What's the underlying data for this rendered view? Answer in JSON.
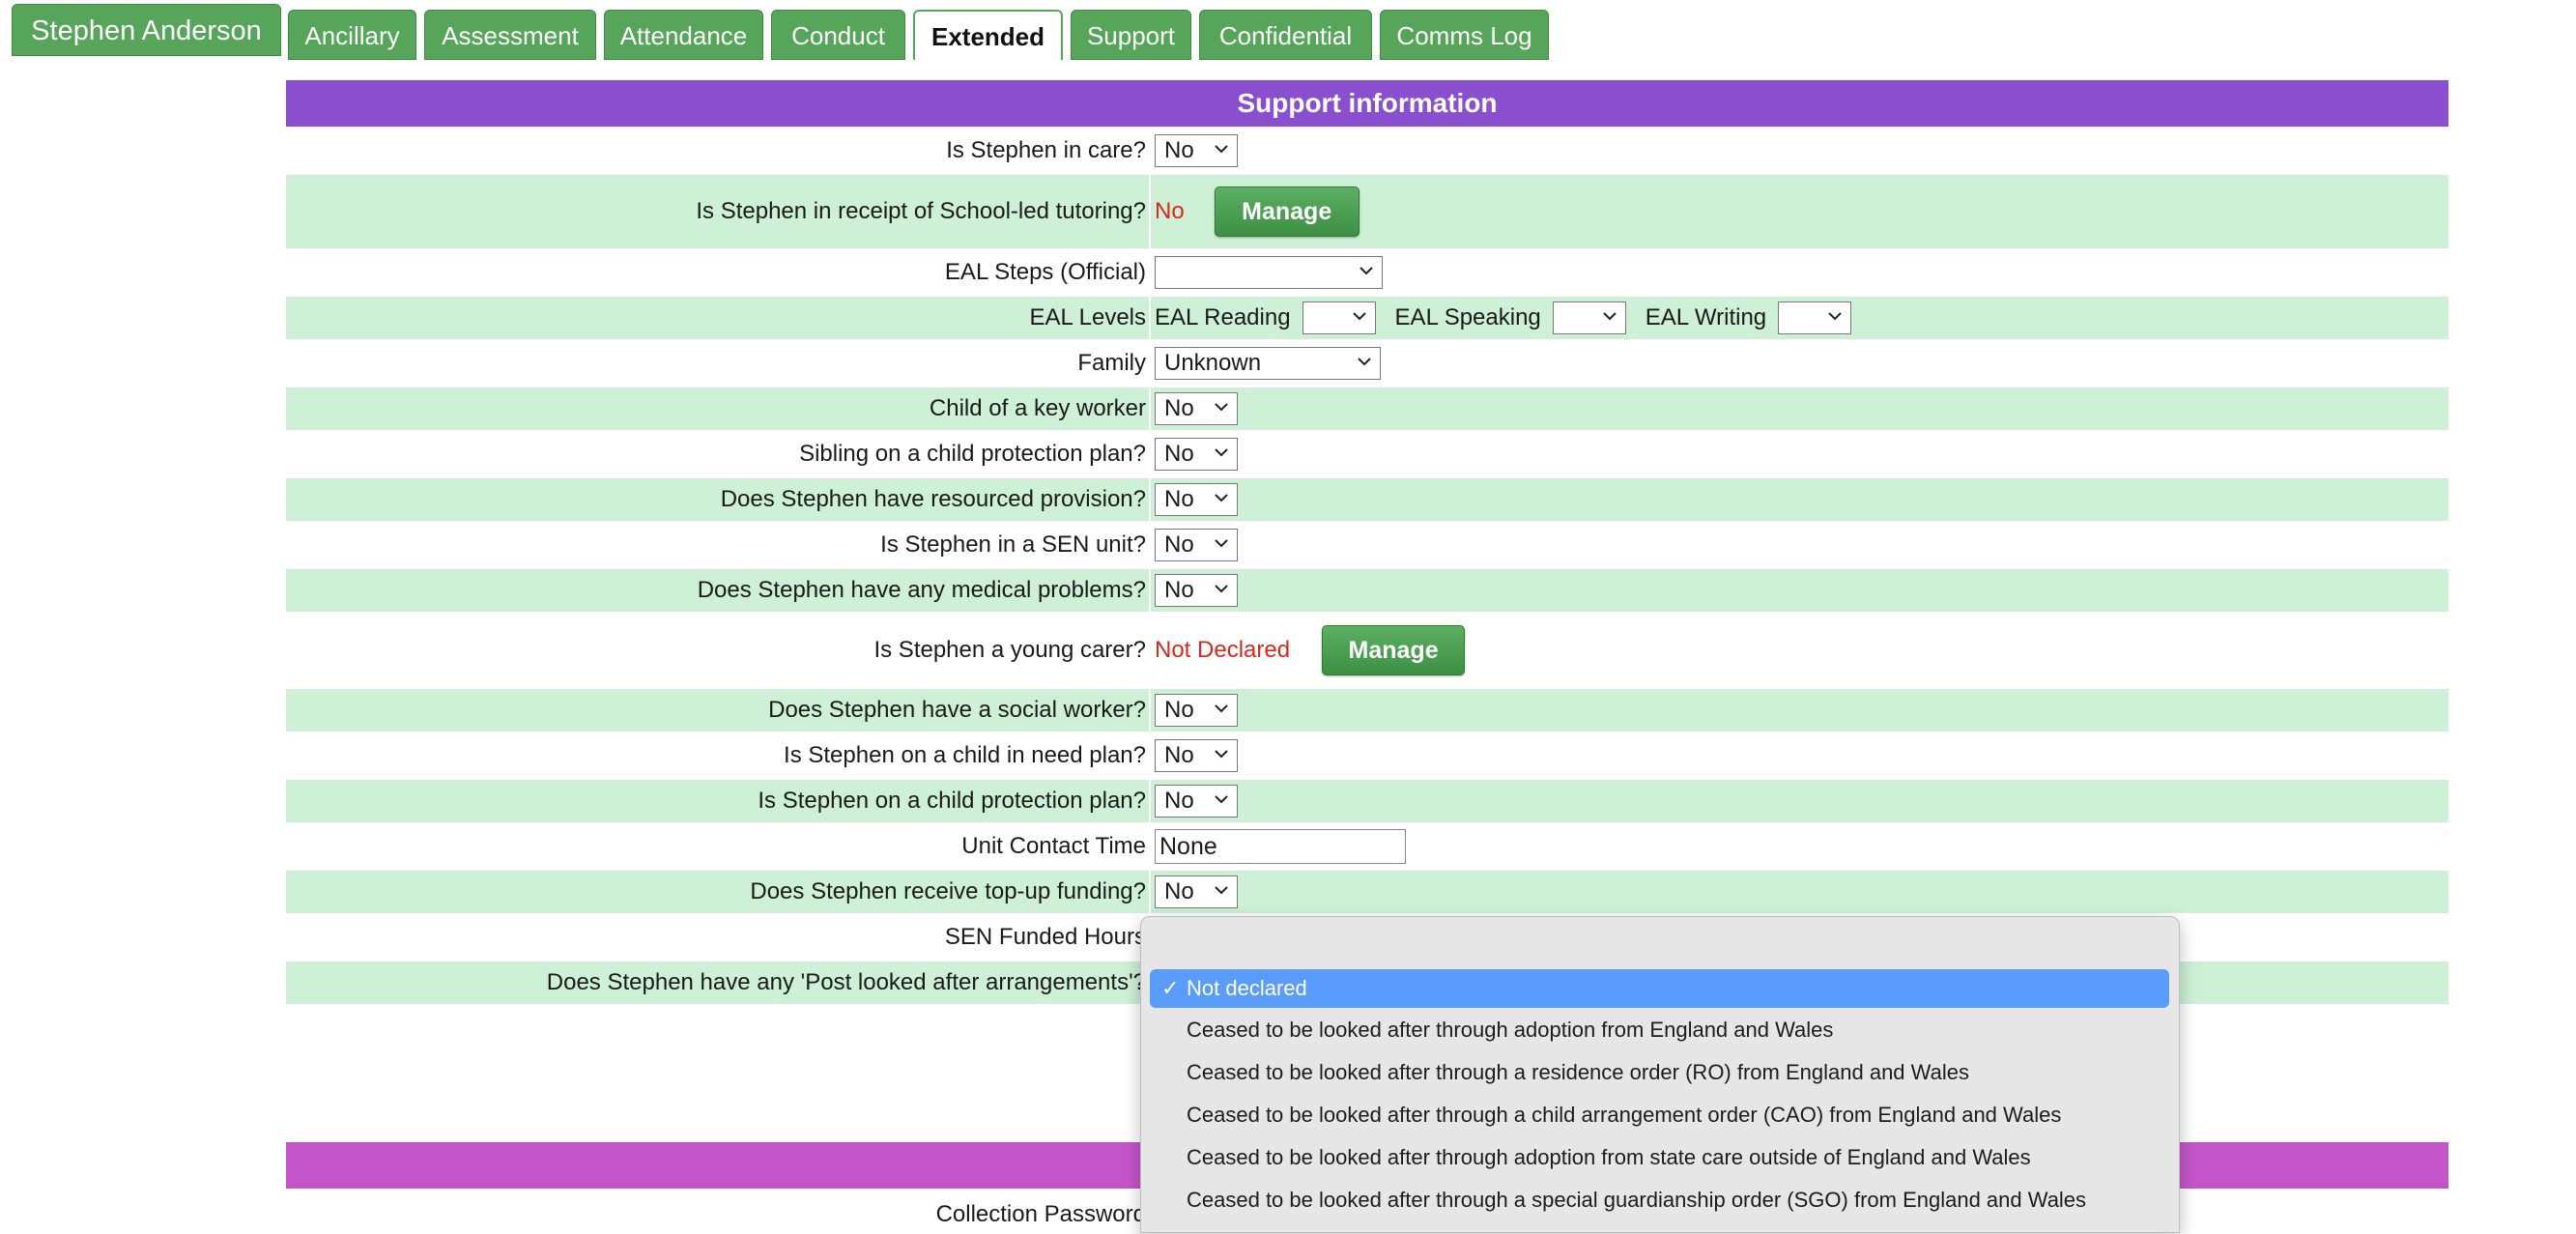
{
  "tabs": [
    {
      "label": "Stephen Anderson",
      "active": false
    },
    {
      "label": "Ancillary",
      "active": false
    },
    {
      "label": "Assessment",
      "active": false
    },
    {
      "label": "Attendance",
      "active": false
    },
    {
      "label": "Conduct",
      "active": false
    },
    {
      "label": "Extended",
      "active": true
    },
    {
      "label": "Support",
      "active": false
    },
    {
      "label": "Confidential",
      "active": false
    },
    {
      "label": "Comms Log",
      "active": false
    }
  ],
  "section_title": "Support information",
  "rows": {
    "in_care": {
      "label": "Is Stephen in care?",
      "value": "No"
    },
    "tutoring": {
      "label": "Is Stephen in receipt of School-led tutoring?",
      "value": "No",
      "button": "Manage"
    },
    "eal_steps": {
      "label": "EAL Steps (Official)",
      "value": ""
    },
    "eal_levels": {
      "label": "EAL Levels",
      "reading": "EAL Reading",
      "speaking": "EAL Speaking",
      "writing": "EAL Writing"
    },
    "family": {
      "label": "Family",
      "value": "Unknown"
    },
    "key_worker": {
      "label": "Child of a key worker",
      "value": "No"
    },
    "sibling_cp": {
      "label": "Sibling on a child protection plan?",
      "value": "No"
    },
    "resourced": {
      "label": "Does Stephen have resourced provision?",
      "value": "No"
    },
    "sen_unit": {
      "label": "Is Stephen in a SEN unit?",
      "value": "No"
    },
    "medical": {
      "label": "Does Stephen have any medical problems?",
      "value": "No"
    },
    "young_carer": {
      "label": "Is Stephen a young carer?",
      "value": "Not Declared",
      "button": "Manage"
    },
    "social_worker": {
      "label": "Does Stephen have a social worker?",
      "value": "No"
    },
    "child_need": {
      "label": "Is Stephen on a child in need plan?",
      "value": "No"
    },
    "child_protection": {
      "label": "Is Stephen on a child protection plan?",
      "value": "No"
    },
    "unit_contact": {
      "label": "Unit Contact Time",
      "value": "None"
    },
    "topup": {
      "label": "Does Stephen receive top-up funding?",
      "value": "No"
    },
    "sen_hours": {
      "label": "SEN Funded Hours"
    },
    "post_lac": {
      "label": "Does Stephen have any 'Post looked after arrangements'?"
    }
  },
  "collection_label": "Collection Password",
  "dropdown": {
    "options": [
      "Not declared",
      "Ceased to be looked after through adoption from England and Wales",
      "Ceased to be looked after through a residence order (RO) from England and Wales",
      "Ceased to be looked after through a child arrangement order (CAO) from England and Wales",
      "Ceased to be looked after through adoption from state care outside of England and Wales",
      "Ceased to be looked after through a special guardianship order (SGO) from England and Wales"
    ],
    "selected_index": 0,
    "check": "✓"
  },
  "colors": {
    "tab_green": "#56a55a",
    "banner_purple": "#8a4fcf",
    "banner_magenta": "#c455c9",
    "row_alt": "#cdf0d6",
    "status_red": "#d42a1e",
    "highlight_blue": "#5a9cfb"
  }
}
